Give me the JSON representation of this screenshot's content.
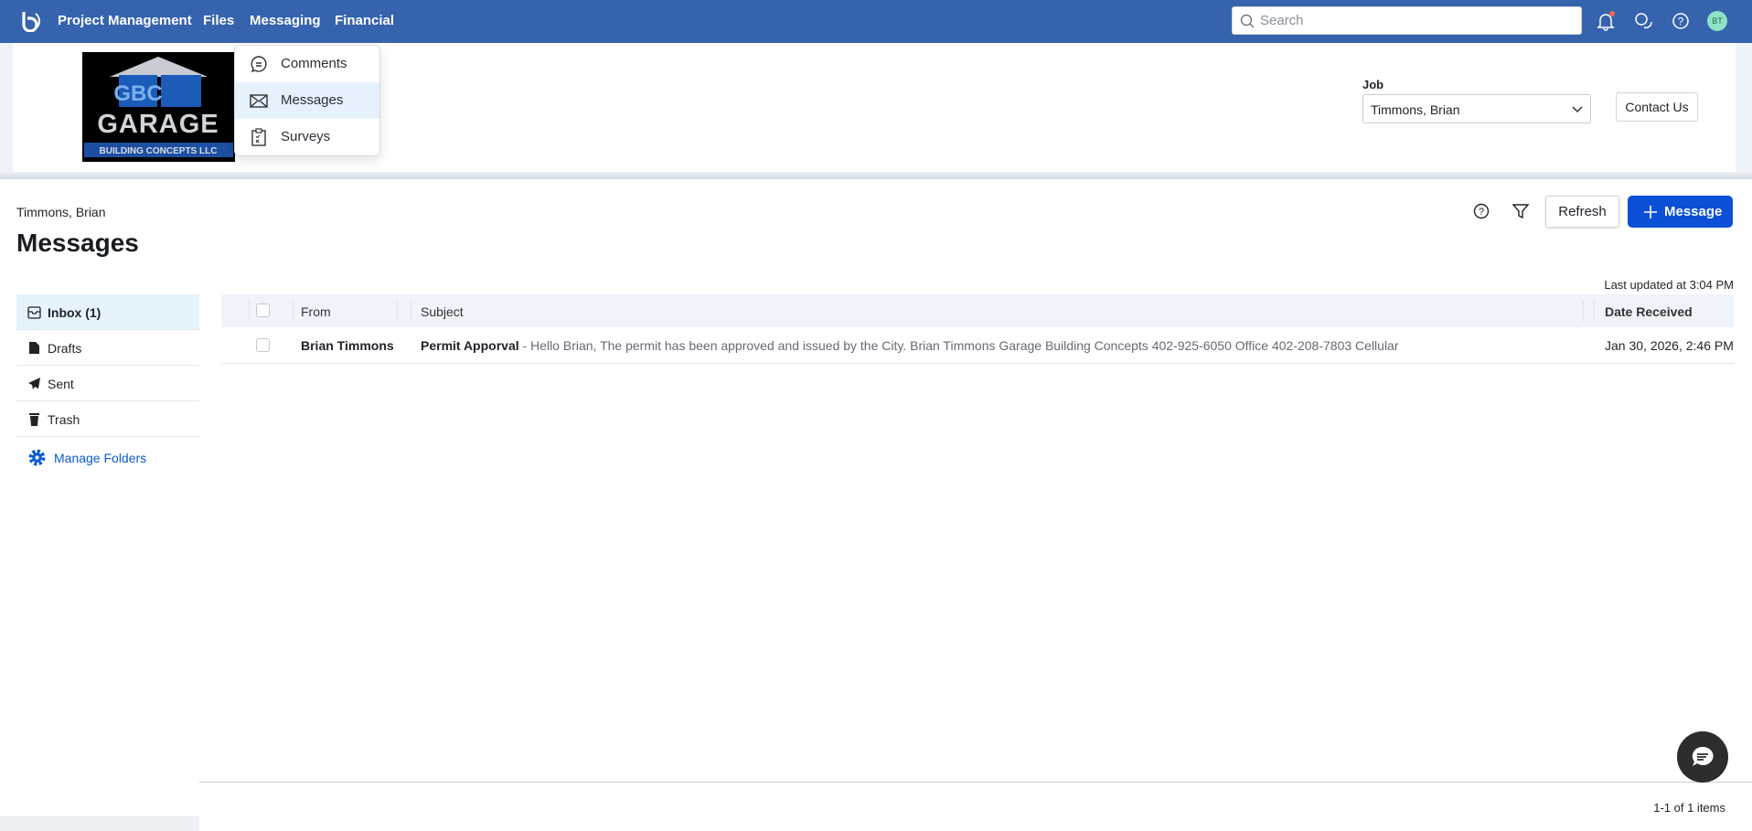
{
  "nav": {
    "items": [
      "Project Management",
      "Files",
      "Messaging",
      "Financial"
    ],
    "search_placeholder": "Search",
    "avatar": "BT"
  },
  "messaging_menu": {
    "items": [
      "Comments",
      "Messages",
      "Surveys"
    ]
  },
  "logo": {
    "text": "GARAGE",
    "subtext": "BUILDING CONCEPTS LLC",
    "mark": "GBC"
  },
  "job": {
    "label": "Job",
    "value": "Timmons, Brian"
  },
  "contact_label": "Contact Us",
  "page": {
    "breadcrumb": "Timmons, Brian",
    "title": "Messages",
    "refresh_label": "Refresh",
    "new_message_label": "Message",
    "last_updated": "Last updated at 3:04 PM"
  },
  "folders": {
    "items": [
      "Inbox (1)",
      "Drafts",
      "Sent",
      "Trash"
    ],
    "manage": "Manage Folders"
  },
  "table": {
    "columns": [
      "From",
      "Subject",
      "Date Received"
    ],
    "rows": [
      {
        "from": "Brian Timmons",
        "subject": "Permit Apporval",
        "preview": " - Hello Brian, The permit has been approved and issued by the City. Brian Timmons Garage Building Concepts 402-925-6050 Office 402-208-7803 Cellular",
        "date": "Jan 30, 2026, 2:46 PM"
      }
    ]
  },
  "pagination": "1-1 of 1 items",
  "colors": {
    "nav": "#3563ae",
    "primary": "#0b50d6",
    "link": "#0b5bd3",
    "active": "#e5f3fd"
  }
}
